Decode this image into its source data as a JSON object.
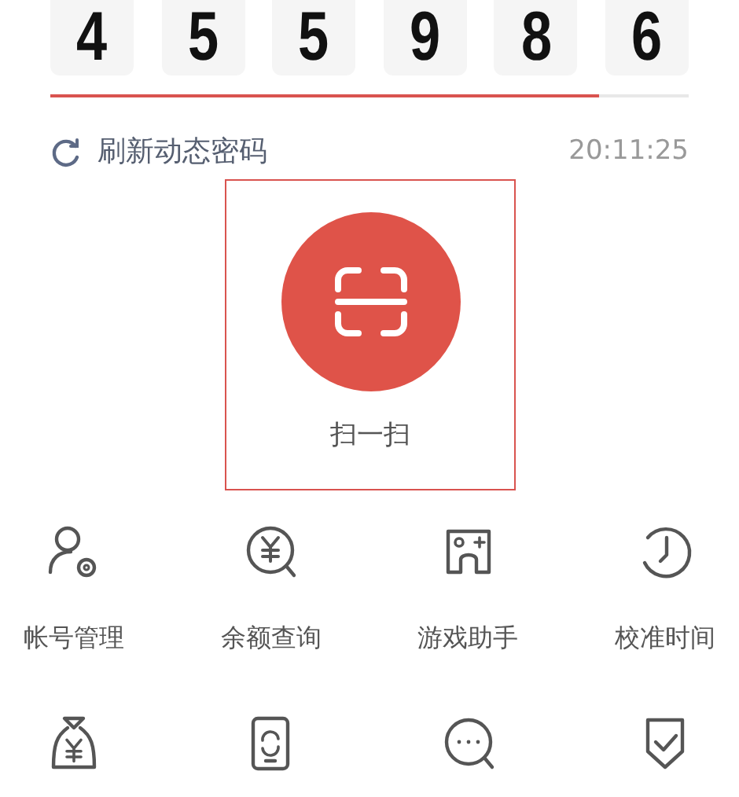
{
  "code_digits": [
    "4",
    "5",
    "5",
    "9",
    "8",
    "6"
  ],
  "countdown": {
    "level": 0.86
  },
  "refresh": {
    "label": "刷新动态密码",
    "time": "20:11:25"
  },
  "scan": {
    "label": "扫一扫"
  },
  "tools": [
    {
      "label": "帐号管理"
    },
    {
      "label": "余额查询"
    },
    {
      "label": "游戏助手"
    },
    {
      "label": "校准时间"
    }
  ]
}
